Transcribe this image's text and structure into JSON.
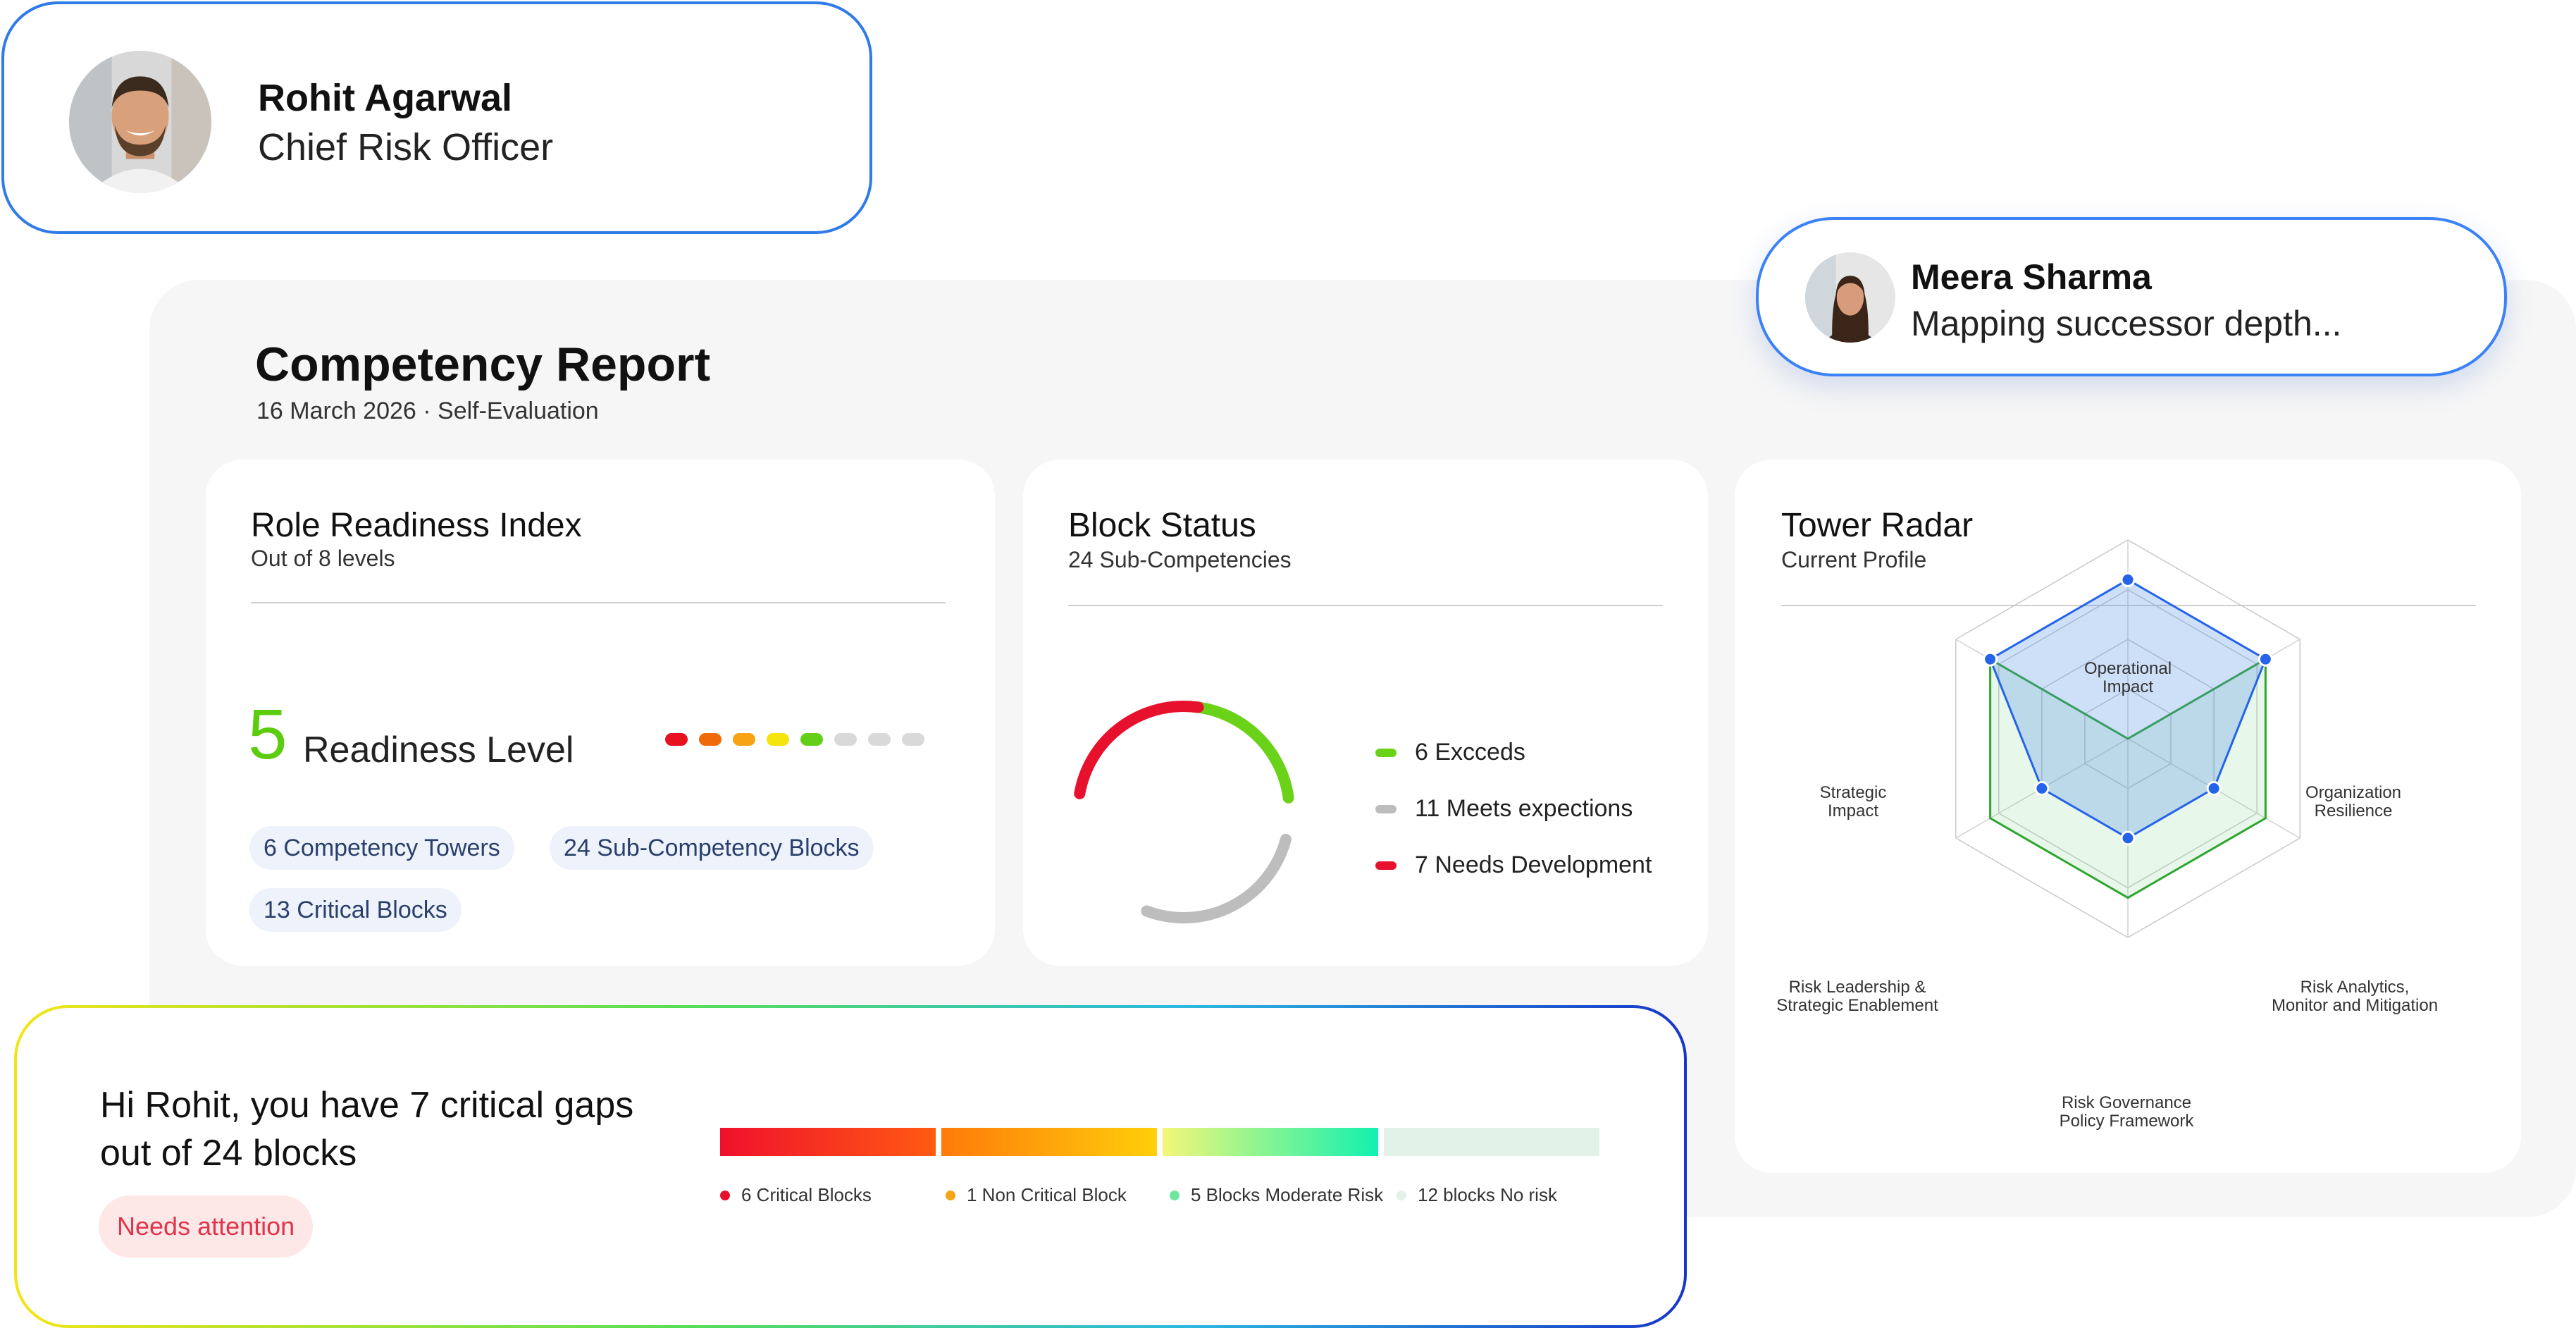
{
  "profile": {
    "name": "Rohit Agarwal",
    "role": "Chief Risk Officer"
  },
  "toast": {
    "name": "Meera Sharma",
    "message": "Mapping successor depth..."
  },
  "report": {
    "title": "Competency Report",
    "subtitle": "16 March 2026 · Self-Evaluation"
  },
  "readiness": {
    "title": "Role Readiness Index",
    "subtitle": "Out of 8 levels",
    "level": "5",
    "level_label": "Readiness Level",
    "level_value": 5,
    "level_max": 8,
    "dot_colors": [
      "#e8111f",
      "#f06a0c",
      "#f6a315",
      "#f4e60d",
      "#63cf1b",
      "#d9d9d9",
      "#d9d9d9",
      "#d9d9d9"
    ],
    "chips": {
      "towers": "6 Competency Towers",
      "blocks": "24 Sub-Competency Blocks",
      "critical": "13 Critical Blocks"
    }
  },
  "block_status": {
    "title": "Block Status",
    "subtitle": "24 Sub-Competencies",
    "legend": {
      "exceeds": "6 Excceds",
      "meets": "11 Meets expections",
      "needs": "7 Needs Development"
    },
    "colors": {
      "exceeds": "#6bd21a",
      "meets": "#bdbdbd",
      "needs": "#e8112d"
    }
  },
  "radar": {
    "title": "Tower Radar",
    "subtitle": "Current Profile",
    "axes": [
      "Operational Impact",
      "Organization Resilience",
      "Risk Analytics, Monitor and Mitigation",
      "Risk Governance Policy Framework",
      "Risk Leadership & Strategic Enablement",
      "Strategic Impact"
    ],
    "label_lines": [
      [
        "Operational",
        "Impact"
      ],
      [
        "Organization",
        "Resilience"
      ],
      [
        "Risk Analytics,",
        "Monitor and Mitigation"
      ],
      [
        "Risk Governance",
        "Policy Framework"
      ],
      [
        "Risk Leadership &",
        "Strategic Enablement"
      ],
      [
        "Strategic",
        "Impact"
      ]
    ],
    "current": [
      0.8,
      0.8,
      0.5,
      0.5,
      0.5,
      0.8
    ],
    "target": [
      0,
      0.8,
      0.8,
      0.8,
      0.8,
      0.8
    ],
    "colors": {
      "current": "#2563eb",
      "target": "#2ea52e"
    }
  },
  "alert": {
    "message": "Hi Rohit, you have 7 critical gaps out of 24 blocks",
    "badge": "Needs attention",
    "segments": {
      "critical": "6  Critical Blocks",
      "non_critical": "1 Non Critical Block",
      "moderate": "5 Blocks Moderate Risk",
      "no_risk": "12 blocks No risk"
    }
  }
}
